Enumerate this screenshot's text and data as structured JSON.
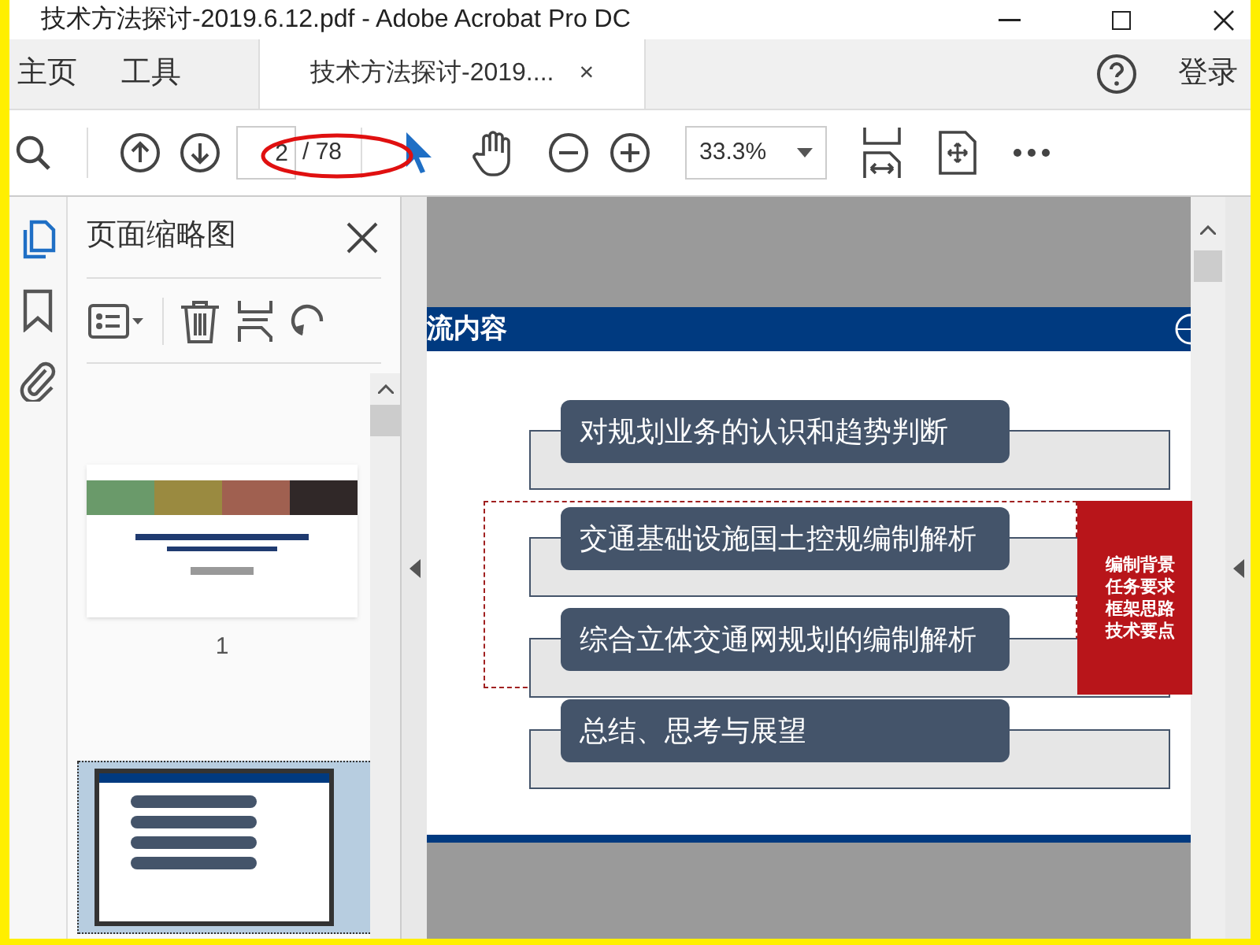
{
  "window": {
    "title": "技术方法探讨-2019.6.12.pdf - Adobe Acrobat Pro DC"
  },
  "tabs": [
    {
      "label": "主页",
      "selected": false
    },
    {
      "label": "工具",
      "selected": false
    },
    {
      "label": "技术方法探讨-2019....",
      "selected": true,
      "close": "×"
    }
  ],
  "help": {
    "label": "登录"
  },
  "toolbar": {
    "page": "2",
    "page_count": "/ 78",
    "zoom": "33.3%"
  },
  "side_rail": [
    {
      "kind": "pages",
      "selected": true
    },
    {
      "kind": "bookmarks",
      "selected": false
    },
    {
      "kind": "attachments",
      "selected": false
    }
  ],
  "thumbnail_panel": {
    "title": "页面缩略图",
    "thumbnails": [
      {
        "kind": "cover",
        "label": "1",
        "selected": false
      },
      {
        "kind": "contents",
        "selected": true
      }
    ]
  },
  "page": {
    "header": "流内容",
    "items": [
      {
        "text": "对规划业务的认识和趋势判断",
        "highlighted": false
      },
      {
        "text": "交通基础设施国土控规编制解析",
        "highlighted": true
      },
      {
        "text": "综合立体交通网规划的编制解析",
        "highlighted": true
      },
      {
        "text": "总结、思考与展望",
        "highlighted": false
      }
    ],
    "callout": [
      "编制背景",
      "任务要求",
      "框架思路",
      "技术要点"
    ]
  }
}
